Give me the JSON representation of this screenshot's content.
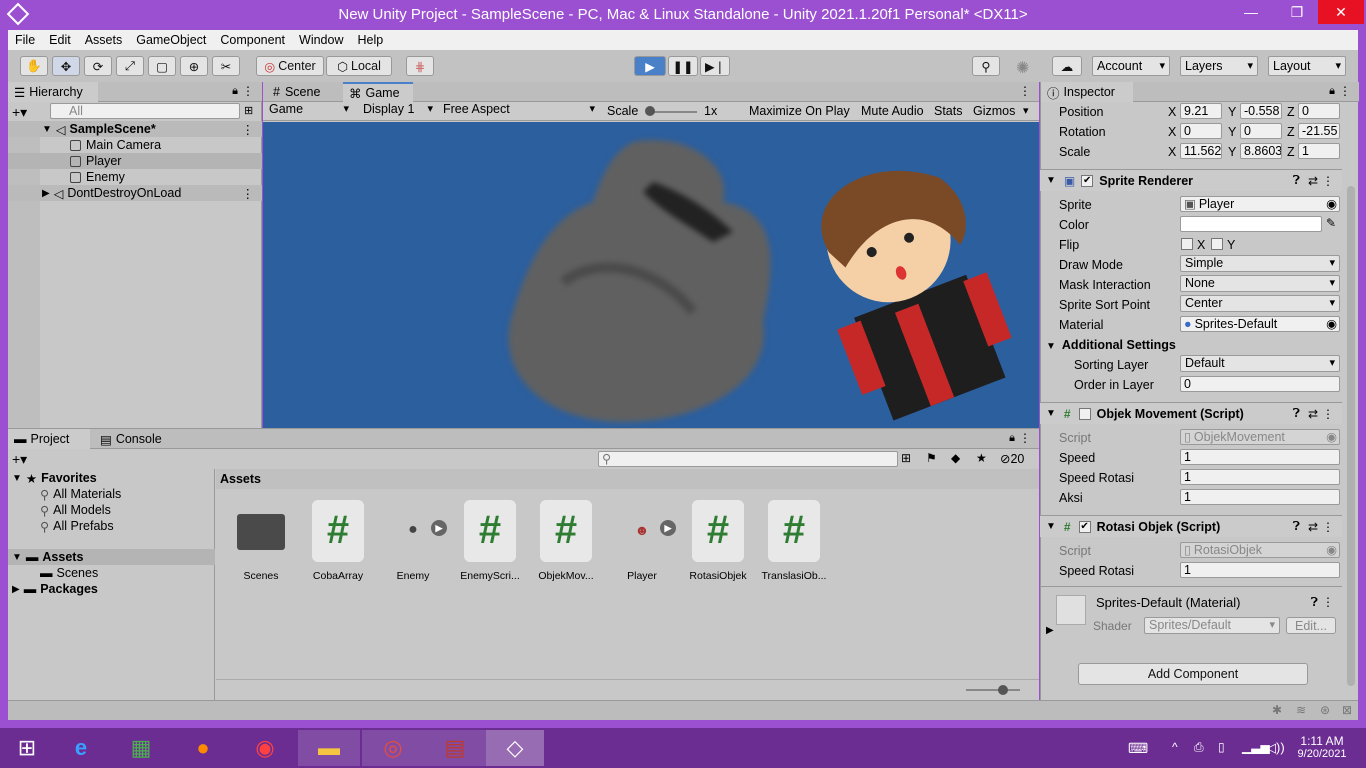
{
  "window": {
    "title": "New Unity Project - SampleScene - PC, Mac & Linux Standalone - Unity 2021.1.20f1 Personal* <DX11>",
    "minimize": "—",
    "maximize": "❐",
    "close": "✕"
  },
  "menu": [
    "File",
    "Edit",
    "Assets",
    "GameObject",
    "Component",
    "Window",
    "Help"
  ],
  "toolbar": {
    "center_label": "Center",
    "local_label": "Local",
    "account_label": "Account",
    "layers_label": "Layers",
    "layout_label": "Layout"
  },
  "hierarchy": {
    "tab": "Hierarchy",
    "search_placeholder": "All",
    "scene": "SampleScene*",
    "items": [
      "Main Camera",
      "Player",
      "Enemy"
    ],
    "ddol": "DontDestroyOnLoad"
  },
  "game": {
    "tabs": [
      "Scene",
      "Game"
    ],
    "view_label": "Game",
    "display_label": "Display 1",
    "aspect_label": "Free Aspect",
    "scale_label": "Scale",
    "scale_value": "1x",
    "maximize_label": "Maximize On Play",
    "mute_label": "Mute Audio",
    "stats_label": "Stats",
    "gizmos_label": "Gizmos"
  },
  "project": {
    "tabs": [
      "Project",
      "Console"
    ],
    "favorites_label": "Favorites",
    "favorites": [
      "All Materials",
      "All Models",
      "All Prefabs"
    ],
    "assets_root": "Assets",
    "scenes_folder": "Scenes",
    "packages_label": "Packages",
    "breadcrumb": "Assets",
    "badge_count": "20",
    "assets": [
      "Scenes",
      "CobaArray",
      "Enemy",
      "EnemyScri...",
      "ObjekMov...",
      "Player",
      "RotasiObjek",
      "TranslasiOb..."
    ]
  },
  "inspector": {
    "tab": "Inspector",
    "transform": {
      "position_label": "Position",
      "rotation_label": "Rotation",
      "scale_label": "Scale",
      "pos": [
        "9.21",
        "-0.558",
        "0"
      ],
      "rot": [
        "0",
        "0",
        "-21.55"
      ],
      "scale": [
        "11.562",
        "8.8603",
        "1"
      ]
    },
    "sprite_renderer": {
      "title": "Sprite Renderer",
      "sprite_label": "Sprite",
      "sprite_value": "Player",
      "color_label": "Color",
      "flip_label": "Flip",
      "flip_x": "X",
      "flip_y": "Y",
      "draw_mode_label": "Draw Mode",
      "draw_mode_value": "Simple",
      "mask_label": "Mask Interaction",
      "mask_value": "None",
      "sort_point_label": "Sprite Sort Point",
      "sort_point_value": "Center",
      "material_label": "Material",
      "material_value": "Sprites-Default",
      "additional_label": "Additional Settings",
      "sorting_layer_label": "Sorting Layer",
      "sorting_layer_value": "Default",
      "order_label": "Order in Layer",
      "order_value": "0"
    },
    "objek_movement": {
      "title": "Objek Movement (Script)",
      "script_label": "Script",
      "script_value": "ObjekMovement",
      "speed_label": "Speed",
      "speed_value": "1",
      "speed_rot_label": "Speed Rotasi",
      "speed_rot_value": "1",
      "aksi_label": "Aksi",
      "aksi_value": "1"
    },
    "rotasi_objek": {
      "title": "Rotasi Objek (Script)",
      "script_label": "Script",
      "script_value": "RotasiObjek",
      "speed_rot_label": "Speed Rotasi",
      "speed_rot_value": "1"
    },
    "material": {
      "title": "Sprites-Default (Material)",
      "shader_label": "Shader",
      "shader_value": "Sprites/Default",
      "edit_label": "Edit..."
    },
    "add_component": "Add Component"
  },
  "taskbar": {
    "time": "1:11 AM",
    "date": "9/20/2021"
  },
  "colors": {
    "titlebar": "#9b4fd1",
    "game_bg": "#2c5f9e",
    "taskbar": "#6c2d93"
  }
}
